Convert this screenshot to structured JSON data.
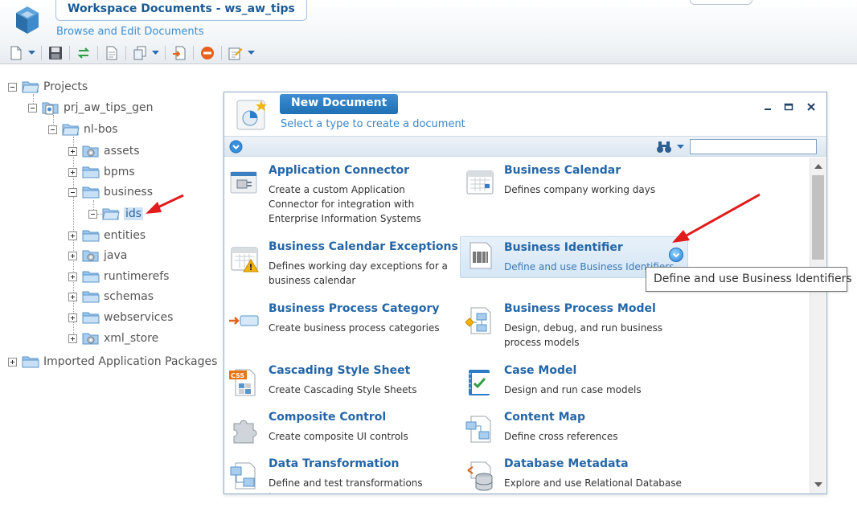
{
  "header": {
    "title": "Workspace Documents - ws_aw_tips",
    "subtitle": "Browse and Edit Documents"
  },
  "toolbar": {
    "buttons": [
      "new-document-icon",
      "save-icon",
      "sync-icon",
      "page-icon",
      "copy-icon",
      "import-icon",
      "stop-icon",
      "edit-icon"
    ]
  },
  "tree": {
    "root": "Projects",
    "project": "prj_aw_tips_gen",
    "folder": "nl-bos",
    "children": [
      "assets",
      "bpms",
      "business",
      "entities",
      "java",
      "runtimerefs",
      "schemas",
      "webservices",
      "xml_store"
    ],
    "selected_child": "ids",
    "imported": "Imported Application Packages"
  },
  "dialog": {
    "title": "New Document",
    "subtitle": "Select a type to create a document",
    "search_value": "",
    "types": [
      {
        "name": "Application Connector",
        "desc": "Create a custom Application Connector for integration with Enterprise Information Systems",
        "icon": "connector-icon"
      },
      {
        "name": "Business Calendar",
        "desc": "Defines company working days",
        "icon": "calendar-icon"
      },
      {
        "name": "Business Calendar Exceptions",
        "desc": "Defines working day exceptions for a business calendar",
        "icon": "calendar-warning-icon"
      },
      {
        "name": "Business Identifier",
        "desc": "Define and use Business Identifiers",
        "icon": "barcode-icon"
      },
      {
        "name": "Business Process Category",
        "desc": "Create business process categories",
        "icon": "category-arrow-icon"
      },
      {
        "name": "Business Process Model",
        "desc": "Design, debug, and run business process models",
        "icon": "process-model-icon"
      },
      {
        "name": "Cascading Style Sheet",
        "desc": "Create Cascading Style Sheets",
        "icon": "css-icon"
      },
      {
        "name": "Case Model",
        "desc": "Design and run case models",
        "icon": "case-model-icon"
      },
      {
        "name": "Composite Control",
        "desc": "Create composite UI controls",
        "icon": "puzzle-icon"
      },
      {
        "name": "Content Map",
        "desc": "Define cross references",
        "icon": "content-map-icon"
      },
      {
        "name": "Data Transformation",
        "desc": "Define and test transformations between",
        "icon": "transformation-icon"
      },
      {
        "name": "Database Metadata",
        "desc": "Explore and use Relational Database",
        "icon": "database-icon"
      }
    ]
  },
  "tooltip": "Define and use Business Identifiers",
  "colors": {
    "accent": "#1e6fb4",
    "link": "#2466a8",
    "annotation_arrow": "#e21b1b"
  }
}
